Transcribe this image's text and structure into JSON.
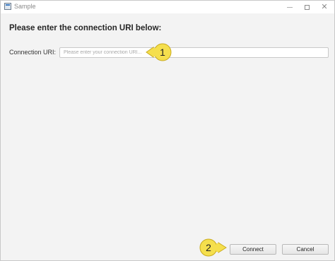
{
  "window": {
    "title": "Sample",
    "icon": "app-window-icon",
    "controls": [
      "minimize-icon",
      "maximize-icon",
      "close-icon"
    ]
  },
  "form": {
    "heading": "Please enter the connection URI below:",
    "uri_label": "Connection URI:",
    "uri_placeholder": "Please enter your connection URI...",
    "uri_value": ""
  },
  "buttons": {
    "connect": "Connect",
    "cancel": "Cancel"
  },
  "callouts": {
    "first": "1",
    "second": "2"
  },
  "colors": {
    "callout_fill": "#f5df4d",
    "callout_stroke": "#c9ab1f"
  }
}
